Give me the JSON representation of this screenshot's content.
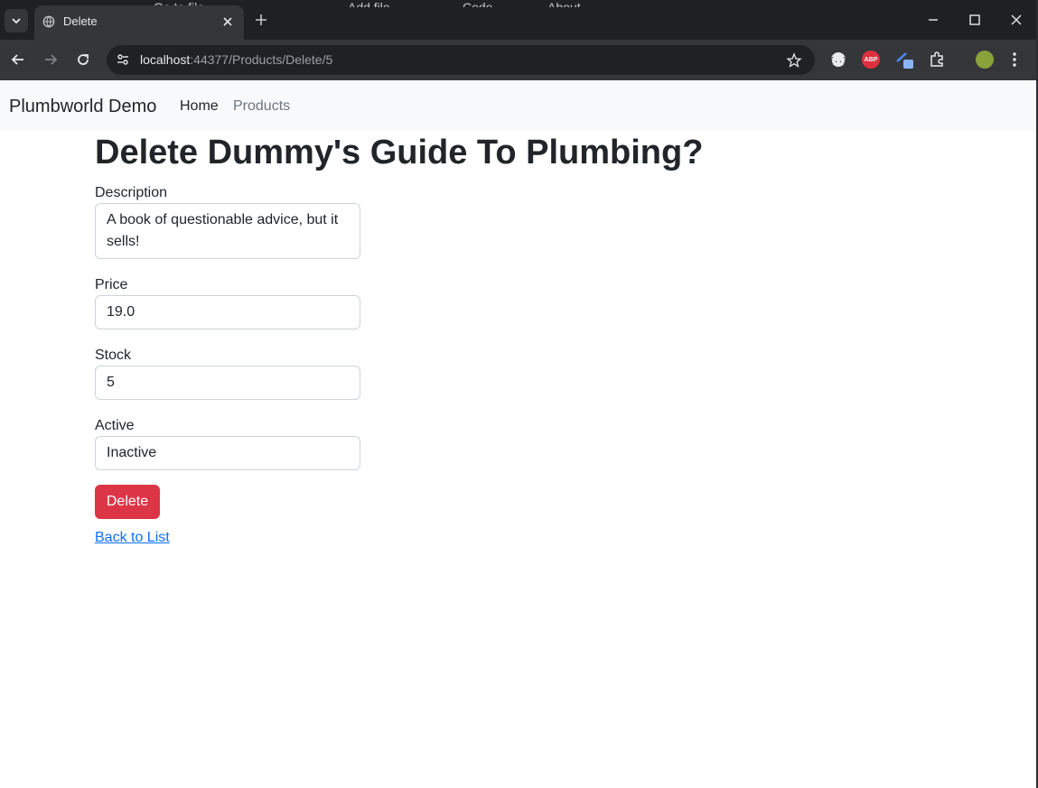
{
  "browser": {
    "peek_tabs": [
      "Go to file",
      "Add file",
      "Code",
      "About"
    ],
    "tab": {
      "title": "Delete"
    },
    "address": {
      "host": "localhost",
      "path": ":44377/Products/Delete/5"
    },
    "extensions": {
      "abp_label": "ABP"
    }
  },
  "navbar": {
    "brand": "Plumbworld Demo",
    "links": [
      {
        "label": "Home"
      },
      {
        "label": "Products"
      }
    ]
  },
  "page": {
    "title": "Delete Dummy's Guide To Plumbing?",
    "fields": [
      {
        "label": "Description",
        "value": "A book of questionable advice, but it sells!"
      },
      {
        "label": "Price",
        "value": "19.0"
      },
      {
        "label": "Stock",
        "value": "5"
      },
      {
        "label": "Active",
        "value": "Inactive"
      }
    ],
    "delete_button": "Delete",
    "back_link": "Back to List"
  },
  "colors": {
    "danger": "#dc3545",
    "link": "#0d6efd",
    "navbar_bg": "#f8f9fa",
    "chrome_dark": "#1f2023"
  }
}
